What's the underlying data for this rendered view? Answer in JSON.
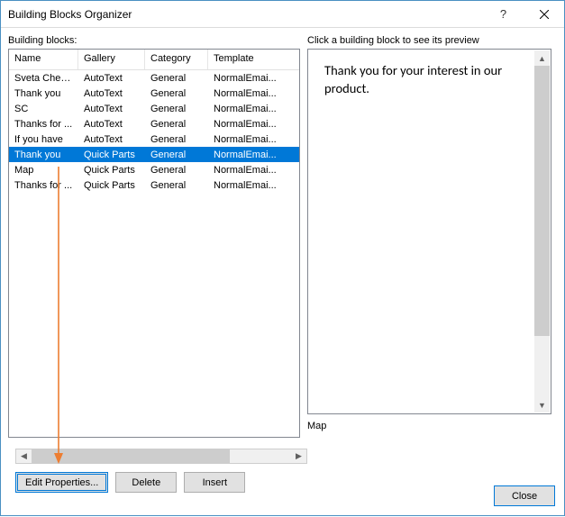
{
  "titlebar": {
    "title": "Building Blocks Organizer"
  },
  "left": {
    "label": "Building blocks:"
  },
  "right": {
    "label": "Click a building block to see its preview"
  },
  "columns": {
    "name": "Name",
    "gallery": "Gallery",
    "category": "Category",
    "template": "Template"
  },
  "rows": [
    {
      "name": "Sveta Cheu...",
      "gallery": "AutoText",
      "category": "General",
      "template": "NormalEmai..."
    },
    {
      "name": "Thank you",
      "gallery": "AutoText",
      "category": "General",
      "template": "NormalEmai..."
    },
    {
      "name": "SC",
      "gallery": "AutoText",
      "category": "General",
      "template": "NormalEmai..."
    },
    {
      "name": "Thanks for ...",
      "gallery": "AutoText",
      "category": "General",
      "template": "NormalEmai..."
    },
    {
      "name": "If you have",
      "gallery": "AutoText",
      "category": "General",
      "template": "NormalEmai..."
    },
    {
      "name": "Thank you",
      "gallery": "Quick Parts",
      "category": "General",
      "template": "NormalEmai...",
      "selected": true
    },
    {
      "name": "Map",
      "gallery": "Quick Parts",
      "category": "General",
      "template": "NormalEmai..."
    },
    {
      "name": "Thanks for ...",
      "gallery": "Quick Parts",
      "category": "General",
      "template": "NormalEmai..."
    }
  ],
  "preview": {
    "text": "Thank you for your interest in our product.",
    "caption": "Map"
  },
  "buttons": {
    "edit": "Edit Properties...",
    "delete": "Delete",
    "insert": "Insert",
    "close": "Close"
  },
  "selected_index": 5
}
